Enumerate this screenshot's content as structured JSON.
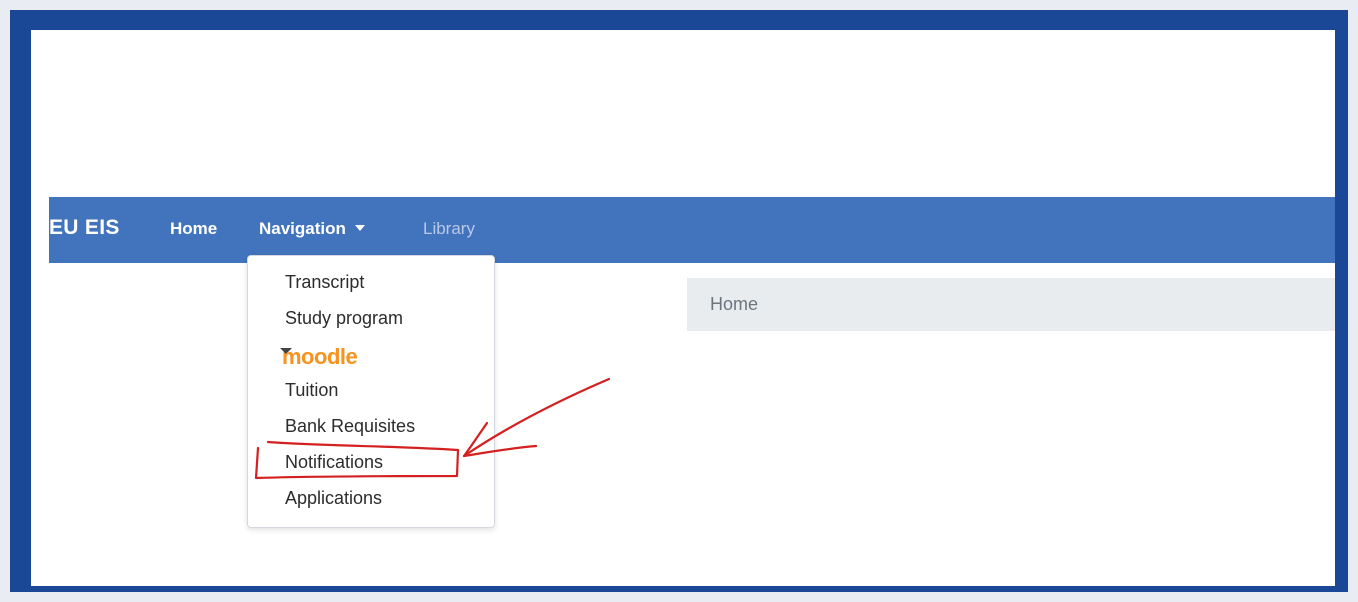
{
  "navbar": {
    "brand": "EU EIS",
    "links": {
      "home": "Home",
      "navigation": "Navigation",
      "library": "Library"
    }
  },
  "dropdown": {
    "items": [
      "Transcript",
      "Study program",
      "moodle",
      "Tuition",
      "Bank Requisites",
      "Notifications",
      "Applications"
    ]
  },
  "breadcrumb": {
    "item": "Home"
  },
  "colors": {
    "frame": "#1b4896",
    "navbar": "#4274bd",
    "moodle": "#f7931e",
    "annotation": "#d42020"
  },
  "annotation": {
    "highlighted_item": "Notifications",
    "icons": [
      "highlight-box",
      "arrow-icon"
    ]
  }
}
